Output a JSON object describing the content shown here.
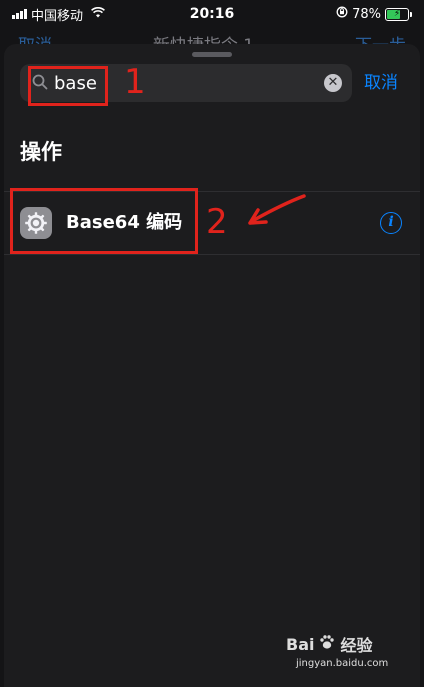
{
  "status_bar": {
    "carrier": "中国移动",
    "time": "20:16",
    "battery_percent": "78%",
    "battery_level": 0.78,
    "icons": [
      "signal-icon",
      "wifi-icon",
      "orientation-lock-icon",
      "battery-icon"
    ]
  },
  "behind_nav": {
    "left_label": "取消",
    "title": "新快捷指令 1",
    "right_label": "下一步"
  },
  "search": {
    "query": "base",
    "cancel_label": "取消"
  },
  "section": {
    "title": "操作"
  },
  "actions": [
    {
      "label": "Base64 编码",
      "icon": "gear-icon",
      "info_icon": "info-icon"
    }
  ],
  "annotations": [
    {
      "label": "1"
    },
    {
      "label": "2"
    }
  ],
  "watermark": {
    "brand": "Bai",
    "brand_suffix": "经验",
    "url": "jingyan.baidu.com"
  },
  "colors": {
    "accent": "#0a84ff",
    "annotation": "#e0231c",
    "background": "#1c1c1e"
  }
}
